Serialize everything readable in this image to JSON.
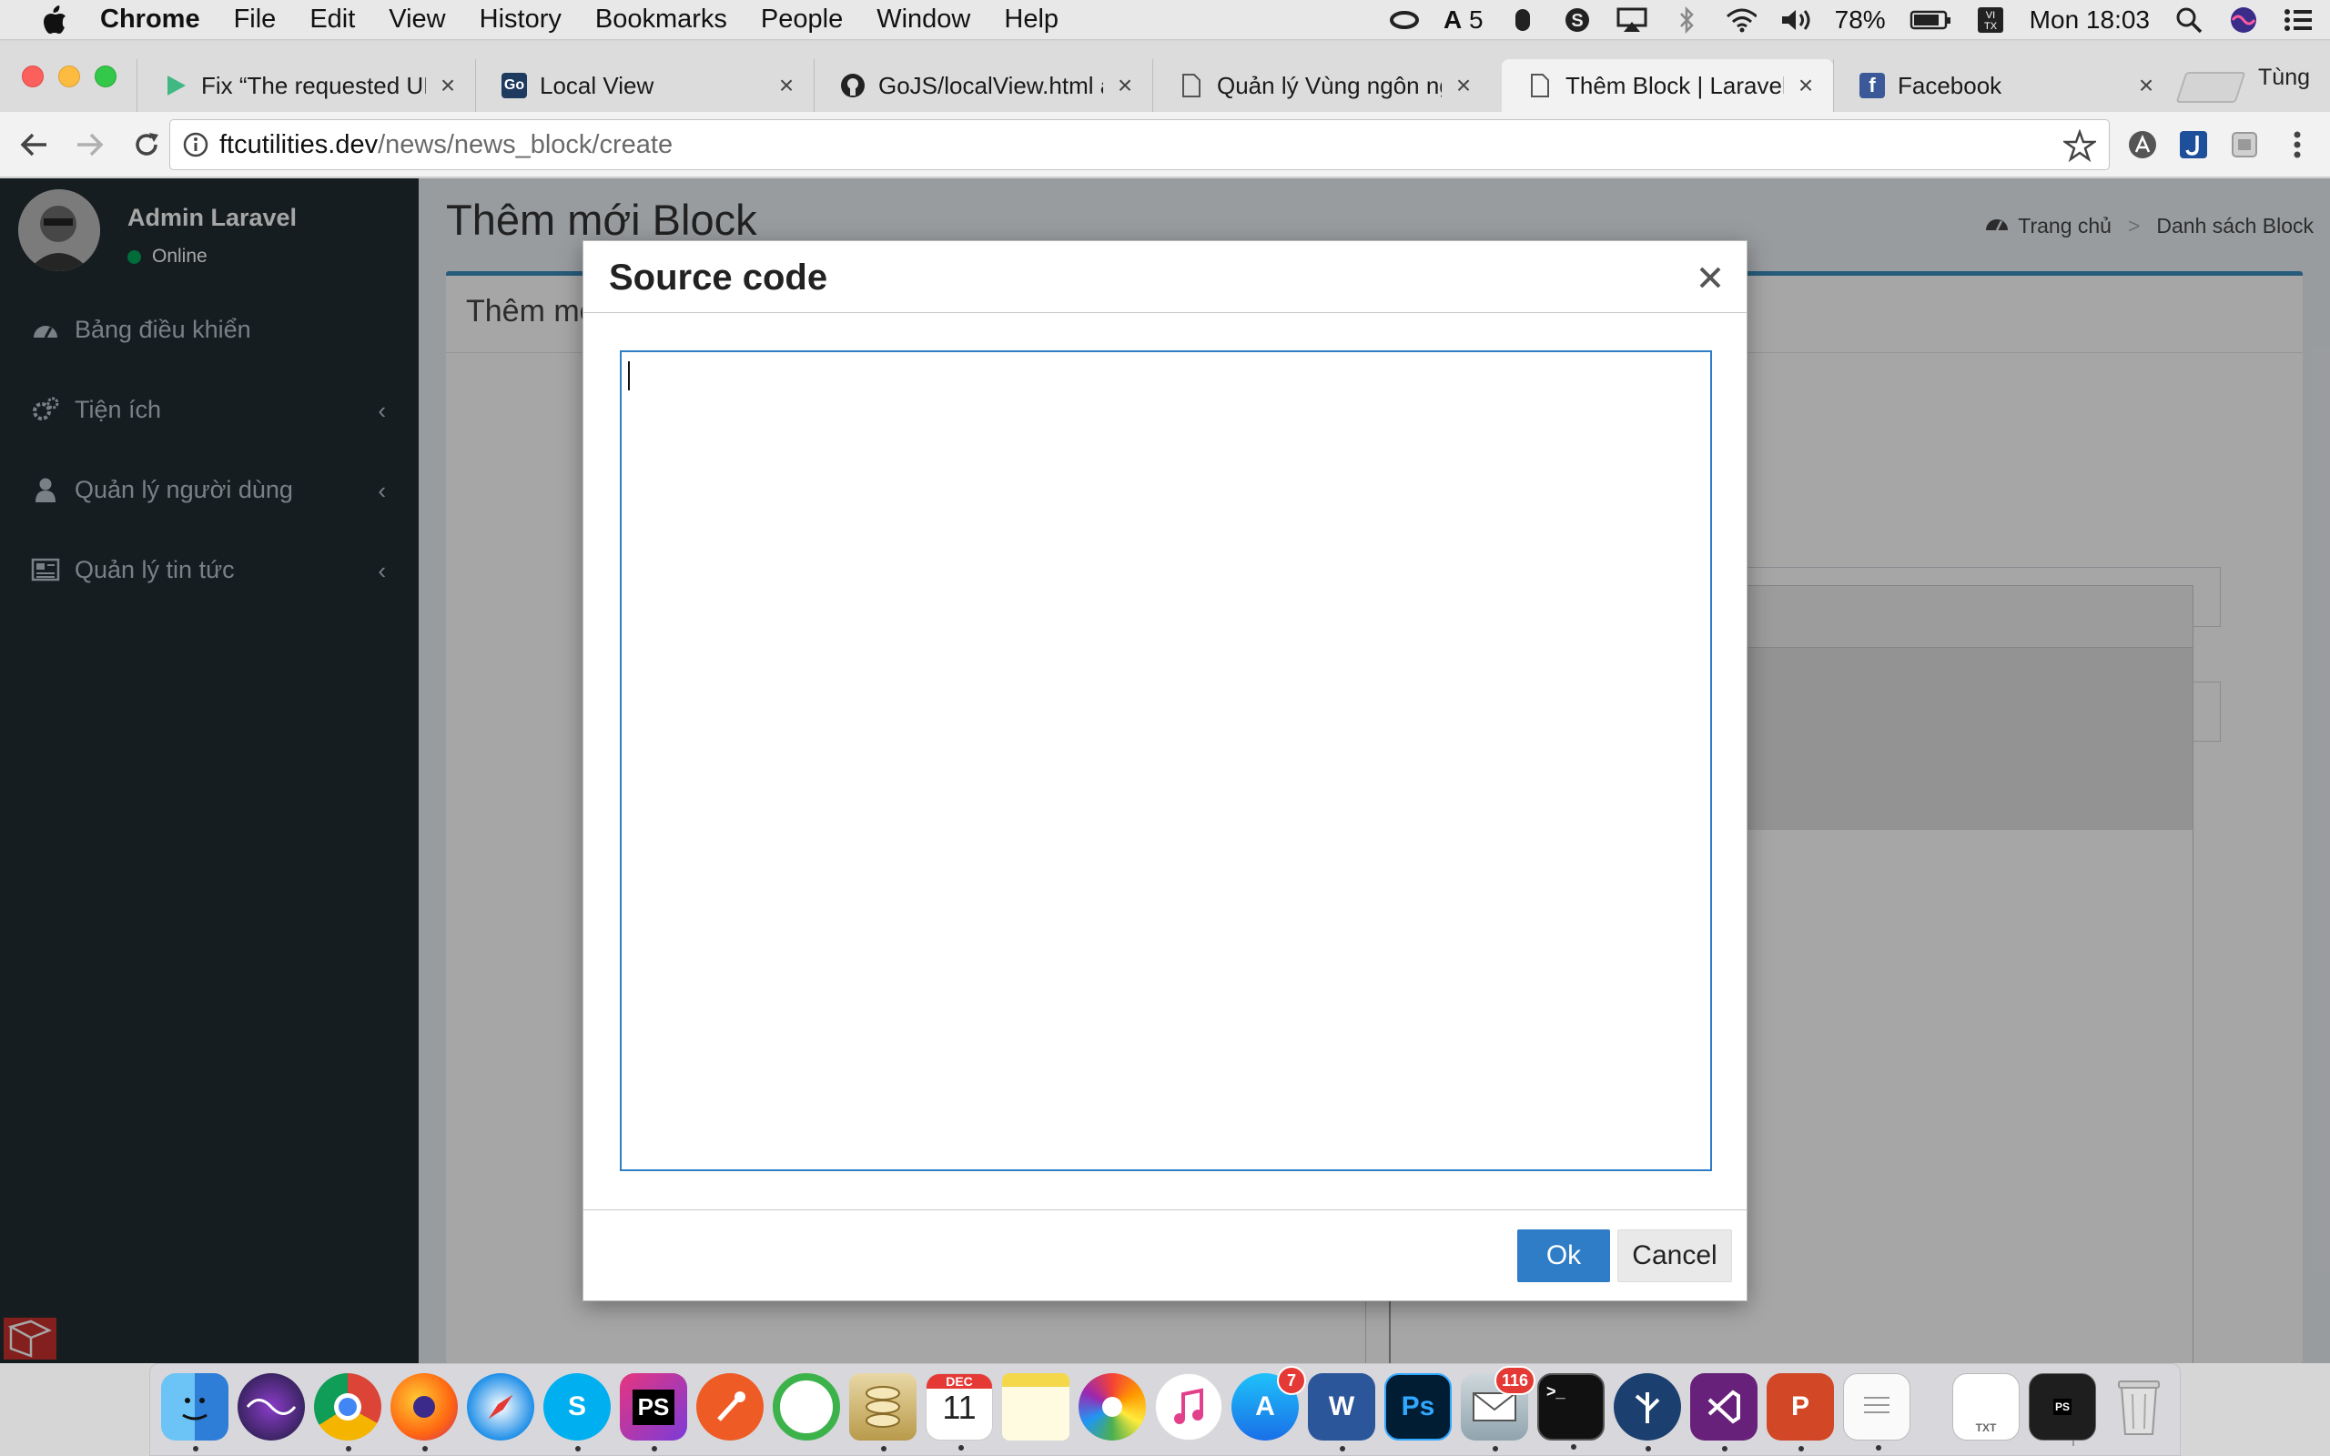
{
  "menubar": {
    "app_name": "Chrome",
    "items": [
      "File",
      "Edit",
      "View",
      "History",
      "Bookmarks",
      "People",
      "Window",
      "Help"
    ],
    "status": {
      "notification_count": "5",
      "battery": "78%",
      "clock": "Mon 18:03",
      "input_method": "VI TX"
    }
  },
  "tabs": [
    {
      "title": "Fix “The requested URL",
      "favicon": "play-icon",
      "active": false
    },
    {
      "title": "Local View",
      "favicon": "gojs-icon",
      "active": false
    },
    {
      "title": "GoJS/localView.html at",
      "favicon": "github-icon",
      "active": false
    },
    {
      "title": "Quản lý Vùng ngôn ngữ",
      "favicon": "document-icon",
      "active": false
    },
    {
      "title": "Thêm Block | Laravel",
      "favicon": "document-icon",
      "active": true
    },
    {
      "title": "Facebook",
      "favicon": "facebook-icon",
      "active": false
    }
  ],
  "profile_name": "Tùng",
  "address": {
    "host": "ftcutilities.dev",
    "path": "/news/news_block/create"
  },
  "sidebar": {
    "user_name": "Admin Laravel",
    "user_status": "Online",
    "items": [
      {
        "label": "Bảng điều khiển",
        "icon": "dashboard-icon",
        "has_children": false
      },
      {
        "label": "Tiện ích",
        "icon": "cogs-icon",
        "has_children": true
      },
      {
        "label": "Quản lý người dùng",
        "icon": "user-icon",
        "has_children": true
      },
      {
        "label": "Quản lý tin tức",
        "icon": "newspaper-icon",
        "has_children": true
      }
    ]
  },
  "content": {
    "page_title": "Thêm mới Block",
    "breadcrumb": {
      "home": "Trang chủ",
      "current": "Danh sách Block"
    },
    "box_title": "Thêm mớ"
  },
  "modal": {
    "title": "Source code",
    "textarea_value": "",
    "ok_label": "Ok",
    "cancel_label": "Cancel"
  },
  "dock": {
    "apps": [
      "Finder",
      "Siri",
      "Chrome",
      "Firefox",
      "Safari",
      "Skype",
      "PhpStorm",
      "Postman",
      "Xcode Sync",
      "Sequel Pro",
      "Calendar",
      "Notes",
      "Photos",
      "iTunes",
      "App Store",
      "Word",
      "Photoshop",
      "Mail",
      "Terminal",
      "Sourcetree",
      "Visual Studio",
      "PowerPoint",
      "TextEdit",
      "Document TXT",
      "PhpStorm Window",
      "Trash"
    ],
    "calendar_month": "DEC",
    "calendar_day": "11",
    "app_store_badge": "7",
    "mail_badge": "116"
  },
  "colors": {
    "sidebar_bg": "#222d32",
    "accent_blue": "#3c8dbc",
    "ok_button": "#2f7dc6",
    "online_green": "#00a65a"
  }
}
